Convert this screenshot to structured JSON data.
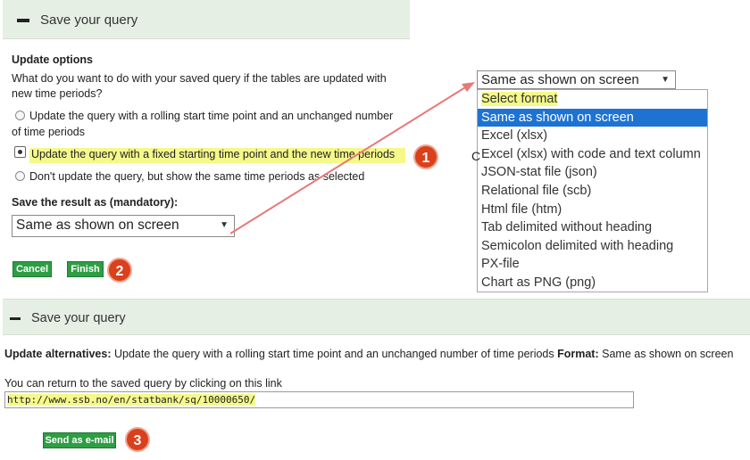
{
  "top_panel": {
    "header_title": "Save your query",
    "update_options_heading": "Update options",
    "question_line1": "What do you want to do with your saved query if the tables are updated with",
    "question_line2": "new time periods?",
    "option1_line1": "Update the query with a rolling start time point and an unchanged number",
    "option1_line2": "of time periods",
    "option2": "Update the query with a fixed starting time point and the new time periods",
    "option3": "Don't update the query, but show the same time periods as selected",
    "save_as_label": "Save the result as (mandatory):",
    "save_as_value": "Same as shown on screen",
    "cancel_label": "Cancel",
    "finish_label": "Finish"
  },
  "format_dropdown": {
    "selected_value": "Same as shown on screen",
    "options": [
      "Select format",
      "Same as shown on screen",
      "Excel (xlsx)",
      "Excel (xlsx) with code and text column",
      "JSON-stat file (json)",
      "Relational file (scb)",
      "Html file (htm)",
      "Tab delimited without heading",
      "Semicolon delimited with heading",
      "PX-file",
      "Chart as PNG (png)"
    ],
    "highlighted_option": "Same as shown on screen"
  },
  "bottom_panel": {
    "header_title": "Save your query",
    "update_alt_label": "Update alternatives:",
    "update_alt_value": "Update the query with a rolling start time point and an unchanged number of time periods",
    "format_label": "Format:",
    "format_value": "Same as shown on screen",
    "return_text": "You can return to the saved query by clicking on this link",
    "url": "http://www.ssb.no/en/statbank/sq/10000650/",
    "send_email_label": "Send as e-mail"
  },
  "annotations": {
    "badge1": "1",
    "badge2": "2",
    "badge3": "3",
    "stray_char": "C"
  },
  "colors": {
    "header_bg": "#e6efe4",
    "button_green": "#2e9e45",
    "highlight_yellow": "#f4f98a",
    "badge_red": "#d9401c",
    "selection_blue": "#1e73d2",
    "arrow_color": "#e8787a"
  }
}
